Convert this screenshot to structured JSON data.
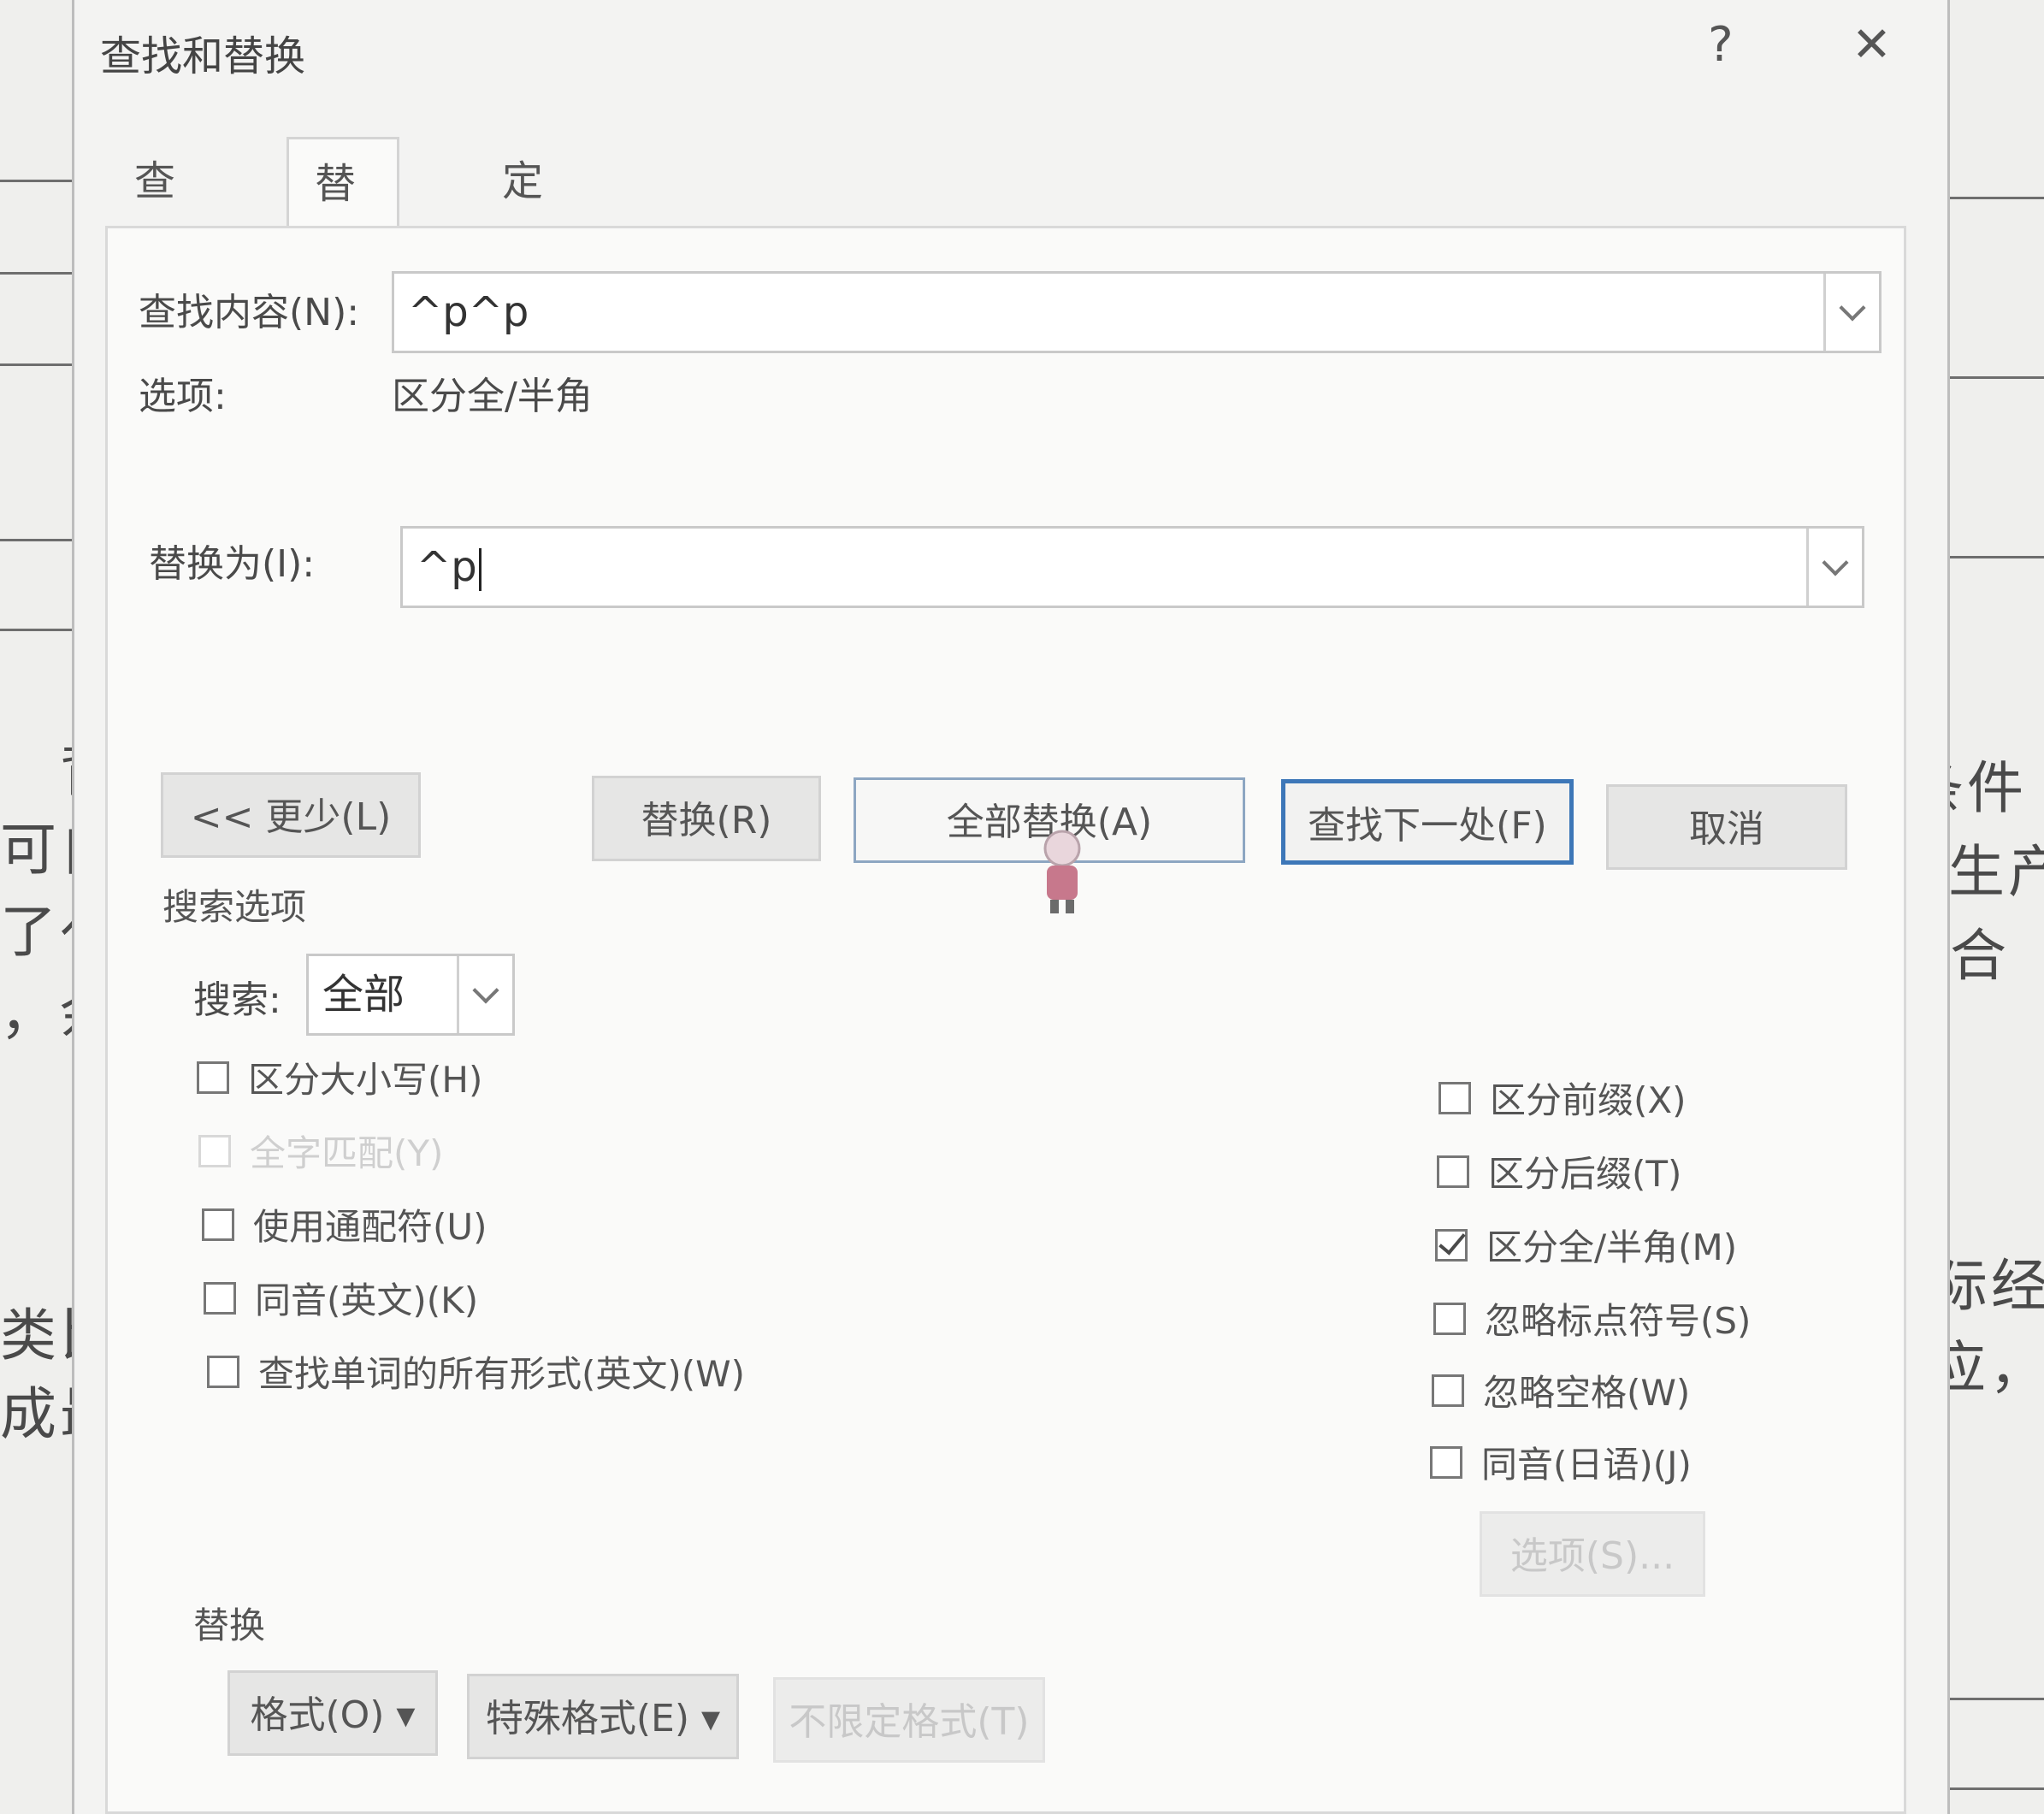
{
  "background_document": {
    "left_fragments": [
      "背",
      "可自",
      "了亻",
      "，余",
      "类比",
      "成最"
    ],
    "right_fragments": [
      "条件",
      "高生产",
      "符合",
      "实际经",
      "适应，"
    ]
  },
  "dialog": {
    "title": "查找和替换",
    "help_label": "?",
    "close_label": "✕",
    "tabs": [
      {
        "label": "查找(D)",
        "active": false
      },
      {
        "label": "替换(P)",
        "active": true
      },
      {
        "label": "定位(G)",
        "active": false
      }
    ],
    "find": {
      "label": "查找内容(N):",
      "value": "^p^p"
    },
    "options": {
      "label": "选项:",
      "value": "区分全/半角"
    },
    "replace": {
      "label": "替换为(I):",
      "value": "^p"
    },
    "buttons": {
      "less": "<< 更少(L)",
      "replace": "替换(R)",
      "replace_all": "全部替换(A)",
      "find_next": "查找下一处(F)",
      "cancel": "取消"
    },
    "search_options": {
      "heading": "搜索选项",
      "search_label": "搜索:",
      "search_value": "全部",
      "left_checkboxes": [
        {
          "label": "区分大小写(H)",
          "checked": false,
          "disabled": false
        },
        {
          "label": "全字匹配(Y)",
          "checked": false,
          "disabled": true
        },
        {
          "label": "使用通配符(U)",
          "checked": false,
          "disabled": false
        },
        {
          "label": "同音(英文)(K)",
          "checked": false,
          "disabled": false
        },
        {
          "label": "查找单词的所有形式(英文)(W)",
          "checked": false,
          "disabled": false
        }
      ],
      "right_checkboxes": [
        {
          "label": "区分前缀(X)",
          "checked": false,
          "disabled": false
        },
        {
          "label": "区分后缀(T)",
          "checked": false,
          "disabled": false
        },
        {
          "label": "区分全/半角(M)",
          "checked": true,
          "disabled": false
        },
        {
          "label": "忽略标点符号(S)",
          "checked": false,
          "disabled": false
        },
        {
          "label": "忽略空格(W)",
          "checked": false,
          "disabled": false
        },
        {
          "label": "同音(日语)(J)",
          "checked": false,
          "disabled": false
        }
      ],
      "options_button": "选项(S)..."
    },
    "replace_section": {
      "heading": "替换",
      "format_button": "格式(O) ▾",
      "special_button": "特殊格式(E) ▾",
      "no_format_button": "不限定格式(T)"
    }
  }
}
